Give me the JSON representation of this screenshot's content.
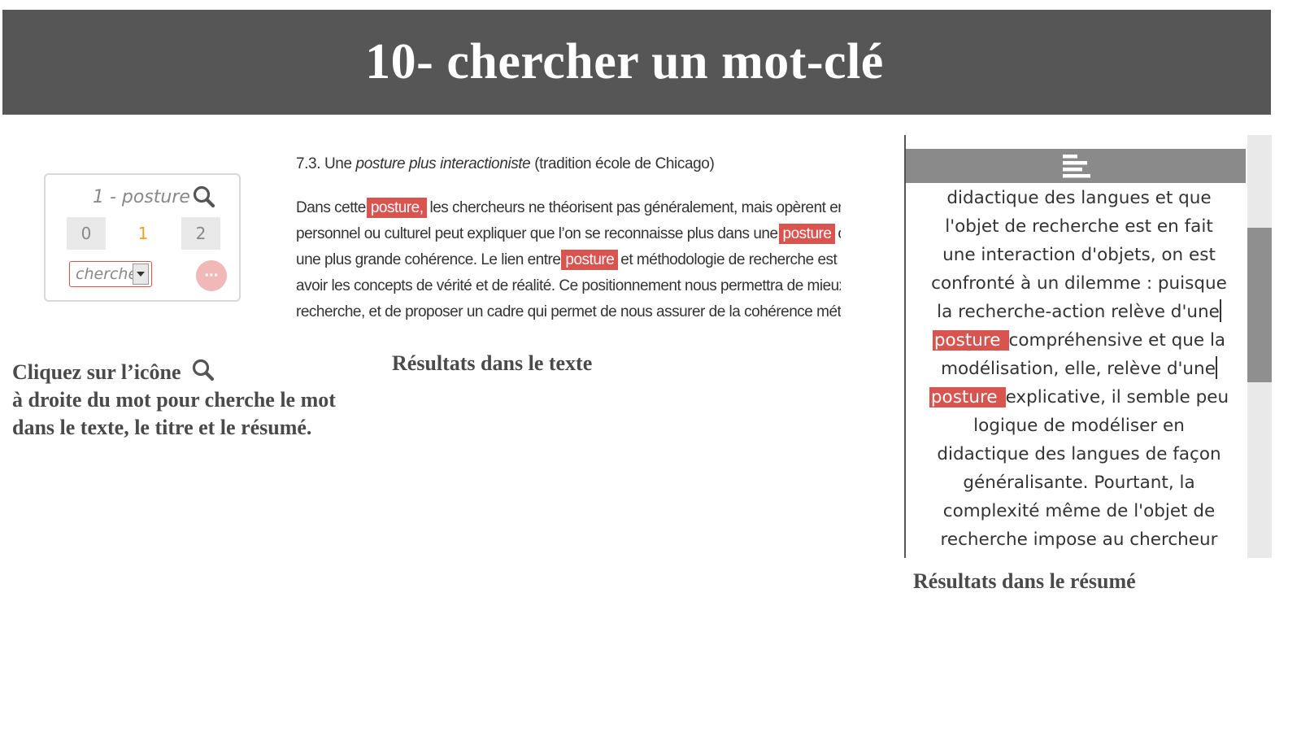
{
  "title": "10- chercher un mot-clé",
  "widget": {
    "keyword_label": "1 - posture",
    "counts": [
      "0",
      "1",
      "2"
    ],
    "select_value": "cherche",
    "more_label": "···"
  },
  "instruction": {
    "line1": "Cliquez sur l’icône",
    "line2": "à droite du mot pour cherche le mot",
    "line3": "dans le texte, le titre et le résumé."
  },
  "excerpt": {
    "heading_prefix": "7.3. Une",
    "heading_italic": "posture plus interactioniste",
    "heading_suffix": "(tradition école de Chicago)",
    "lines": [
      {
        "before": "Dans cette",
        "hl": "posture,",
        "after": "les chercheurs ne théorisent pas généralement, mais opèrent en fonctio"
      },
      {
        "before": "personnel ou culturel peut expliquer que l’on se reconnaisse plus dans une",
        "hl": "posture",
        "after": "ou une"
      },
      {
        "before": "une plus grande cohérence. Le lien entre",
        "hl": "posture",
        "after": "et méthodologie de recherche est évident"
      },
      {
        "before": "avoir les concepts de vérité et de réalité. Ce positionnement nous permettra de mieux concev",
        "hl": "",
        "after": ""
      },
      {
        "before": "recherche, et de proposer un cadre qui permet de nous assurer de la cohérence méthodolog",
        "hl": "",
        "after": ""
      }
    ]
  },
  "caption_text": "Résultats dans le texte",
  "abstract": {
    "lines": [
      {
        "before": "didactique des langues et que",
        "hl": "",
        "after": "",
        "cursor": false
      },
      {
        "before": "l'objet de recherche est en fait",
        "hl": "",
        "after": "",
        "cursor": false
      },
      {
        "before": "une interaction d'objets, on est",
        "hl": "",
        "after": "",
        "cursor": false
      },
      {
        "before": "confronté à un dilemme : puisque",
        "hl": "",
        "after": "",
        "cursor": false
      },
      {
        "before": "la recherche-action relève d'une",
        "hl": "",
        "after": "",
        "cursor": true
      },
      {
        "before": "",
        "hl": "posture",
        "after": "compréhensive et que la",
        "cursor": false
      },
      {
        "before": "modélisation, elle, relève d'une",
        "hl": "",
        "after": "",
        "cursor": true
      },
      {
        "before": "",
        "hl": "posture",
        "after": "explicative, il semble peu",
        "cursor": false
      },
      {
        "before": "logique de modéliser en",
        "hl": "",
        "after": "",
        "cursor": false
      },
      {
        "before": "didactique des langues de façon",
        "hl": "",
        "after": "",
        "cursor": false
      },
      {
        "before": "généralisante. Pourtant, la",
        "hl": "",
        "after": "",
        "cursor": false
      },
      {
        "before": "complexité même de l'objet de",
        "hl": "",
        "after": "",
        "cursor": false
      },
      {
        "before": "recherche impose au chercheur",
        "hl": "",
        "after": "",
        "cursor": false
      }
    ]
  },
  "caption_abstract": "Résultats dans le résumé",
  "colors": {
    "title_bar": "#565656",
    "highlight": "#d9534f",
    "count_active": "#f0a020",
    "more_button": "#f0b8b6"
  },
  "icons": [
    "search-icon",
    "chevron-down-icon",
    "more-icon",
    "align-icon"
  ]
}
